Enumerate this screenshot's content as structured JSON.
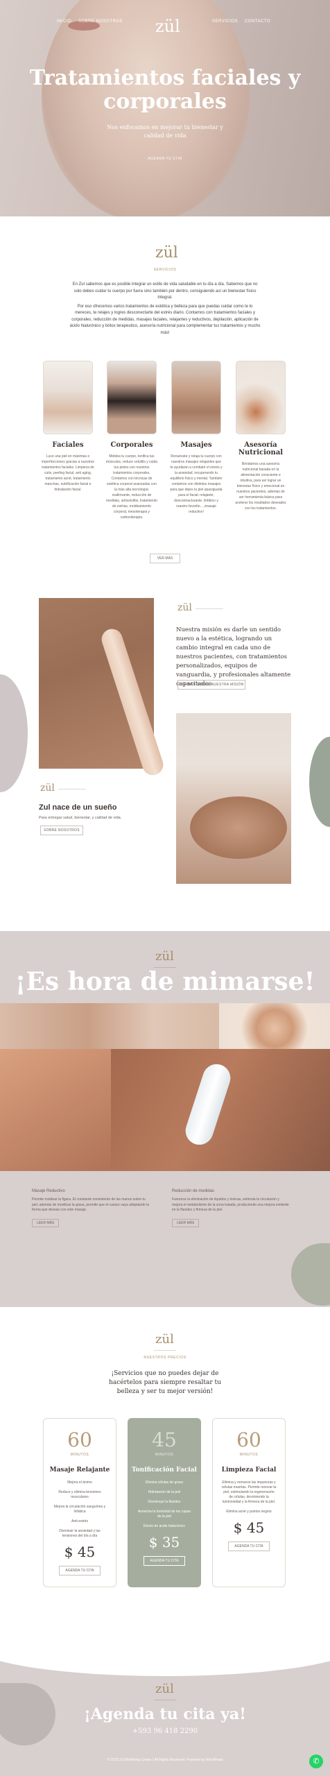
{
  "nav": {
    "left": [
      "INICIO",
      "SOBRE NOSOTROS"
    ],
    "right": [
      "SERVICIOS",
      "CONTACTO"
    ],
    "logo": "zül",
    "logo_tagline": ""
  },
  "hero": {
    "title": "Tratamientos faciales y corporales",
    "subtitle": "Nos enfocamos en mejorar tu bienestar y calidad de vida",
    "cta": "AGENDA TU CITA"
  },
  "intro": {
    "logo": "zül",
    "kicker": "SERVICIOS",
    "paragraphs": [
      "En Zul sabemos que es posible integrar un estilo de vida saludable en tu día a día. Sabemos que no solo debes cuidar tu cuerpo por fuera sino también por dentro, consiguiendo así un bienestar físico integral.",
      "Por eso ofrecemos varios tratamientos de estética y belleza para que puedas cuidar como te lo mereces, te relajes y logres desconectarte del estrés diario. Contamos con tratamientos faciales y corporales, reducción de medidas, masajes faciales, relajantes y reductivos, depilación, aplicación de ácido hialurónico y bótox terapeutico, asesoría nutricional para complementar tus tratamientos y mucho más!"
    ]
  },
  "services": {
    "items": [
      {
        "title": "Faciales",
        "text": "Luce una piel en máximas e imperfecciones gracias a nuestros tratamientos faciales. Limpieza de cutis, peeling facial, anti aging, tratamiento acné, tratamiento manchas, nutrificación facial e hidratación facial."
      },
      {
        "title": "Corporales",
        "text": "Moldea tu cuerpo, tonifica tus músculos, reduce celulitis y cuida tus pieles con nuestros tratamientos corporales. Contamos con técnicas de estética corporal avanzadas con la más alta tecnología: reafirmante, reducción de medidas, anticelulitis, tratamiento de estrías, moldeamiento corporal, mesoterapia y carboxiterapia."
      },
      {
        "title": "Masajes",
        "text": "Renuévate y relaja tu cuerpo con nuestros masajes relajantes que te ayudarán a combatir el estrés y la ansiedad, recuperando tu equilibrio físico y mental. También contamos con distintos masajes para que dejes tu piel apaciguada para el facial: relajante, descontracturante, linfático y nuestro favorito... ¡masaje reductivo!"
      },
      {
        "title": "Asesoría Nutricional",
        "text": "Brindamos una asesoría nutricional basada en la alimentación consciente e intuitiva, para así lograr un bienestar físico y emocional en nuestros pacientes, además de ser herramienta básica para acelerar los resultados deseados con los tratamientos."
      }
    ],
    "see_more": "VER MÁS"
  },
  "mission": {
    "logo": "zül",
    "text": "Nuestra misión es darle un sentido nuevo a la estética, logrando un cambio integral en cada uno de nuestros pacientes, con tratamientos personalizados, equipos de vanguardia, y profesionales altamente capacitados",
    "button": "LEE MÁS SOBRE NUESTRA MISIÓN",
    "dream_logo": "zül",
    "dream_title": "Zul nace de un sueño",
    "dream_sub": "Para entregar salud, bienestar, y calidad de vida.",
    "dream_button": "SOBRE NOSOTROS"
  },
  "pamper": {
    "logo": "zül",
    "title": "¡Es hora de mimarse!",
    "cols": [
      {
        "heading": "Masaje Reductivo",
        "text": "Permite moldear la figura. El constante movimiento de las manos sobre tu piel, además de movilizar la grasa, permite que el cuerpo vaya adoptando la forma que deseas con este masaje.",
        "button": "LEER MÁS"
      },
      {
        "heading": "Reducción de medidas",
        "text": "Favorece la eliminación de líquidos y toxinas, estimula la circulación y mejora el metabolismo de la zona tratada, produciendo una mejora evidente en la flacidez y firmeza de la piel.",
        "button": "LEER MÁS"
      }
    ]
  },
  "prices": {
    "logo": "zül",
    "kicker": "NUESTROS PRECIOS",
    "title": "¡Servicios que no puedes dejar de hacértelos para siempre resaltar tu belleza y ser tu mejor versión!",
    "cards": [
      {
        "minutes": "60",
        "unit": "MINUTOS",
        "title": "Masaje Relajante",
        "features": [
          "Mejora el ánimo",
          "Reduce y elimina tensiones musculares",
          "Mejora la circulación sanguínea y linfática",
          "Anti-estrés",
          "Disminuir la ansiedad y las tensiones del día a día"
        ],
        "price": "$ 45",
        "button": "AGENDA TU CITA"
      },
      {
        "minutes": "45",
        "unit": "MINUTOS",
        "title": "Tonificación Facial",
        "features": [
          "Elimina células de grasa",
          "Hidratación de la piel",
          "Disminuye la flacidez",
          "Aumenta la tonicidad de las capas de la piel",
          "Efecto de ácido hialurónico"
        ],
        "price": "$ 35",
        "button": "AGENDA TU CITA"
      },
      {
        "minutes": "60",
        "unit": "MINUTOS",
        "title": "Limpieza Facial",
        "features": [
          "Elimina y remueve las impurezas y células muertas. Permite renovar la piel, estimulando la regeneración de células, devolviendo la luminosidad y la firmeza de la piel.",
          "Elimina acné y puntos negros"
        ],
        "price": "$ 45",
        "button": "AGENDA TU CITA"
      }
    ]
  },
  "footer": {
    "logo": "zül",
    "title": "¡Agenda tu cita ya!",
    "phone": "+593 96 418 2290",
    "copy": "© 2023 Zul Wellbeing Center | All Rights Reserved. Powered by WordPress",
    "whatsapp_icon": "whatsapp-icon"
  }
}
